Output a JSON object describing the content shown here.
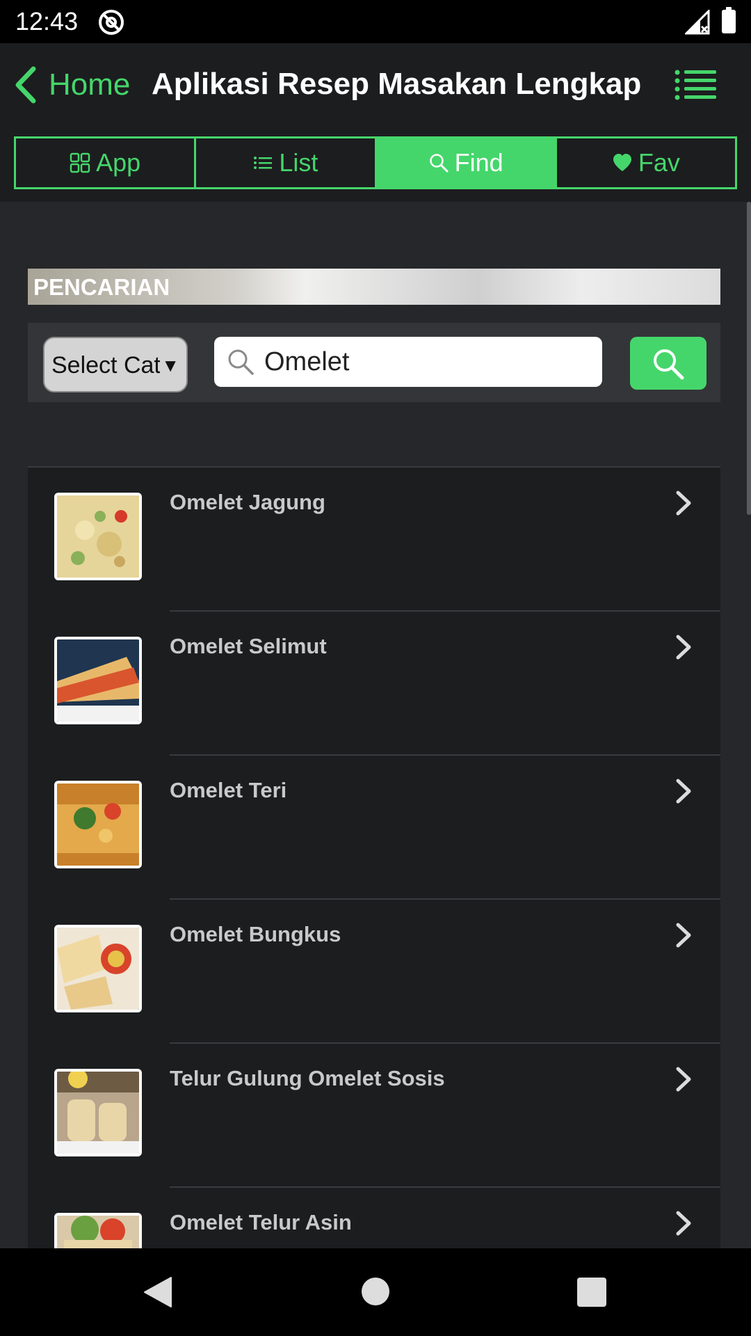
{
  "status_bar": {
    "time": "12:43"
  },
  "header": {
    "back_label": "Home",
    "title": "Aplikasi Resep Masakan Lengkap"
  },
  "tabs": [
    {
      "label": "App",
      "icon": "grid-icon",
      "active": false
    },
    {
      "label": "List",
      "icon": "list-icon",
      "active": false
    },
    {
      "label": "Find",
      "icon": "search-icon",
      "active": true
    },
    {
      "label": "Fav",
      "icon": "heart-icon",
      "active": false
    }
  ],
  "search": {
    "section_label": "PENCARIAN",
    "category_label": "Select Category",
    "query": "Omelet"
  },
  "results": [
    {
      "title": "Omelet Jagung"
    },
    {
      "title": "Omelet Selimut"
    },
    {
      "title": "Omelet Teri"
    },
    {
      "title": "Omelet Bungkus"
    },
    {
      "title": "Telur Gulung Omelet Sosis"
    },
    {
      "title": "Omelet Telur Asin"
    }
  ],
  "colors": {
    "accent": "#45d66b",
    "header_bg": "#1c1d1f",
    "content_bg": "#26272a",
    "row_bg": "#1c1d1f"
  }
}
